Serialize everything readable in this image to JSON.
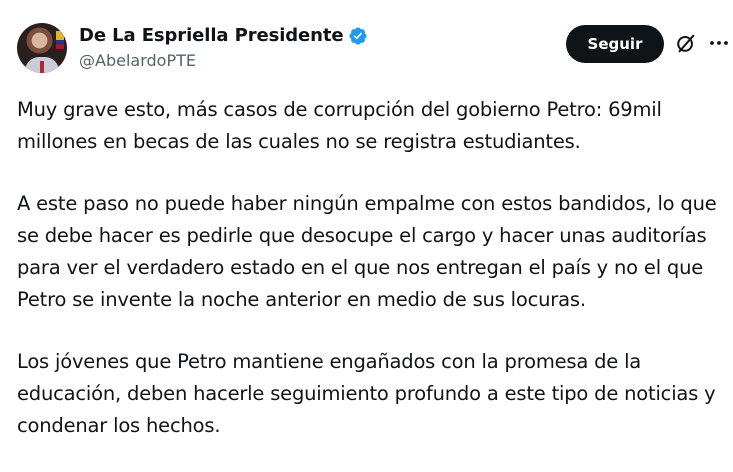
{
  "tweet": {
    "author_name": "De La Espriella Presidente",
    "handle": "@AbelardoPTE",
    "follow_label": "Seguir",
    "verified_color": "#1d9bf0",
    "paragraphs": [
      "Muy grave esto, más casos de corrupción del gobierno Petro: 69mil\nmillones en becas de las cuales no se registra estudiantes.",
      "A este paso no puede haber ningún empalme con estos bandidos, lo que\nse debe hacer es pedirle que desocupe el cargo y hacer unas auditorías\npara ver el verdadero estado en el que nos entregan el país y no el que\nPetro se invente la noche anterior en medio de sus locuras.",
      "Los jóvenes que Petro mantiene engañados con la promesa de la\neducación, deben hacerle seguimiento profundo a este tipo de noticias y\ncondenar los hechos."
    ],
    "icons": [
      "avatar",
      "verified-badge-icon",
      "grok-icon",
      "more-options-icon"
    ]
  }
}
